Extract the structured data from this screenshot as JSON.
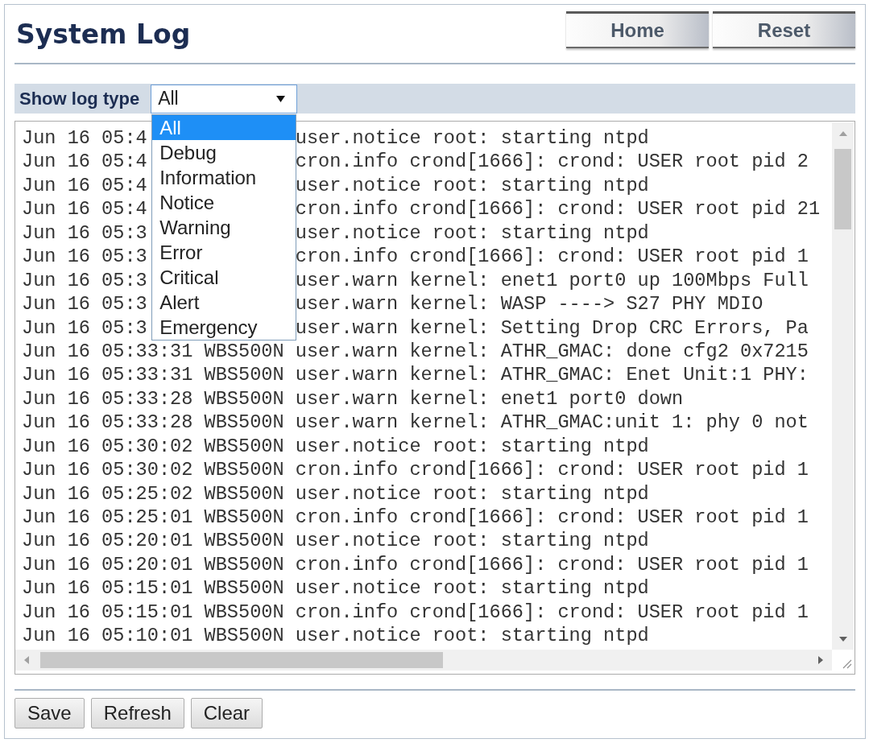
{
  "page": {
    "title": "System Log"
  },
  "header_buttons": [
    "Home",
    "Reset"
  ],
  "log_filter": {
    "label": "Show log type",
    "value": "All",
    "expanded": true,
    "options": [
      {
        "label": "All",
        "selected": true
      },
      {
        "label": "Debug",
        "selected": false
      },
      {
        "label": "Information",
        "selected": false
      },
      {
        "label": "Notice",
        "selected": false
      },
      {
        "label": "Warning",
        "selected": false
      },
      {
        "label": "Error",
        "selected": false
      },
      {
        "label": "Critical",
        "selected": false
      },
      {
        "label": "Alert",
        "selected": false
      },
      {
        "label": "Emergency",
        "selected": false
      }
    ]
  },
  "log": {
    "rows": [
      {
        "time": "Jun 16 05:4",
        "message": "user.notice root: starting ntpd"
      },
      {
        "time": "Jun 16 05:4",
        "message": "cron.info crond[1666]: crond: USER root pid 2"
      },
      {
        "time": "Jun 16 05:4",
        "message": "user.notice root: starting ntpd"
      },
      {
        "time": "Jun 16 05:4",
        "message": "cron.info crond[1666]: crond: USER root pid 21"
      },
      {
        "time": "Jun 16 05:3",
        "message": "user.notice root: starting ntpd"
      },
      {
        "time": "Jun 16 05:3",
        "message": "cron.info crond[1666]: crond: USER root pid 1"
      },
      {
        "time": "Jun 16 05:3",
        "message": "user.warn kernel: enet1 port0 up 100Mbps Full"
      },
      {
        "time": "Jun 16 05:3",
        "message": "user.warn kernel: WASP ----> S27 PHY MDIO"
      },
      {
        "time": "Jun 16 05:3",
        "message": "user.warn kernel: Setting Drop CRC Errors, Pa"
      },
      {
        "time": "Jun 16 05:33:31",
        "host": "WBS500N",
        "message": "user.warn kernel: ATHR_GMAC: done cfg2 0x7215"
      },
      {
        "time": "Jun 16 05:33:31",
        "host": "WBS500N",
        "message": "user.warn kernel: ATHR_GMAC: Enet Unit:1 PHY:"
      },
      {
        "time": "Jun 16 05:33:28",
        "host": "WBS500N",
        "message": "user.warn kernel: enet1 port0 down"
      },
      {
        "time": "Jun 16 05:33:28",
        "host": "WBS500N",
        "message": "user.warn kernel: ATHR_GMAC:unit 1: phy 0 not"
      },
      {
        "time": "Jun 16 05:30:02",
        "host": "WBS500N",
        "message": "user.notice root: starting ntpd"
      },
      {
        "time": "Jun 16 05:30:02",
        "host": "WBS500N",
        "message": "cron.info crond[1666]: crond: USER root pid 1"
      },
      {
        "time": "Jun 16 05:25:02",
        "host": "WBS500N",
        "message": "user.notice root: starting ntpd"
      },
      {
        "time": "Jun 16 05:25:01",
        "host": "WBS500N",
        "message": "cron.info crond[1666]: crond: USER root pid 1"
      },
      {
        "time": "Jun 16 05:20:01",
        "host": "WBS500N",
        "message": "user.notice root: starting ntpd"
      },
      {
        "time": "Jun 16 05:20:01",
        "host": "WBS500N",
        "message": "cron.info crond[1666]: crond: USER root pid 1"
      },
      {
        "time": "Jun 16 05:15:01",
        "host": "WBS500N",
        "message": "user.notice root: starting ntpd"
      },
      {
        "time": "Jun 16 05:15:01",
        "host": "WBS500N",
        "message": "cron.info crond[1666]: crond: USER root pid 1"
      },
      {
        "time": "Jun 16 05:10:01",
        "host": "WBS500N",
        "message": "user.notice root: starting ntpd"
      }
    ]
  },
  "buttons": [
    "Save",
    "Refresh",
    "Clear"
  ]
}
